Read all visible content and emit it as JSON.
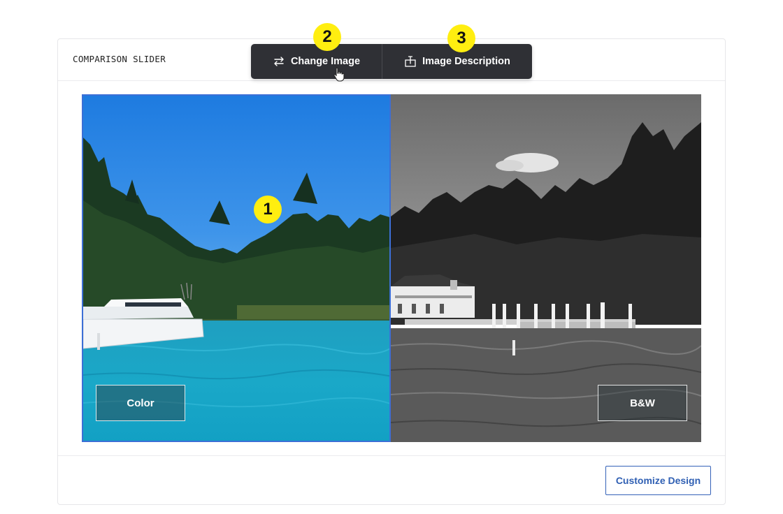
{
  "card": {
    "title": "COMPARISON SLIDER"
  },
  "toolbar": {
    "change_image": {
      "label": "Change Image",
      "icon": "swap-arrows-icon"
    },
    "image_description": {
      "label": "Image Description",
      "icon": "text-box-icon"
    }
  },
  "slider": {
    "left_label": "Color",
    "right_label": "B&W",
    "divider_position_percent": 50
  },
  "footer": {
    "customize_label": "Customize Design"
  },
  "annotations": {
    "badge_1": "1",
    "badge_2": "2",
    "badge_3": "3"
  },
  "colors": {
    "toolbar_bg": "#2f3035",
    "badge_yellow": "#ffee10",
    "accent_blue": "#3c6fd6",
    "customize_text": "#2f5fb3"
  }
}
